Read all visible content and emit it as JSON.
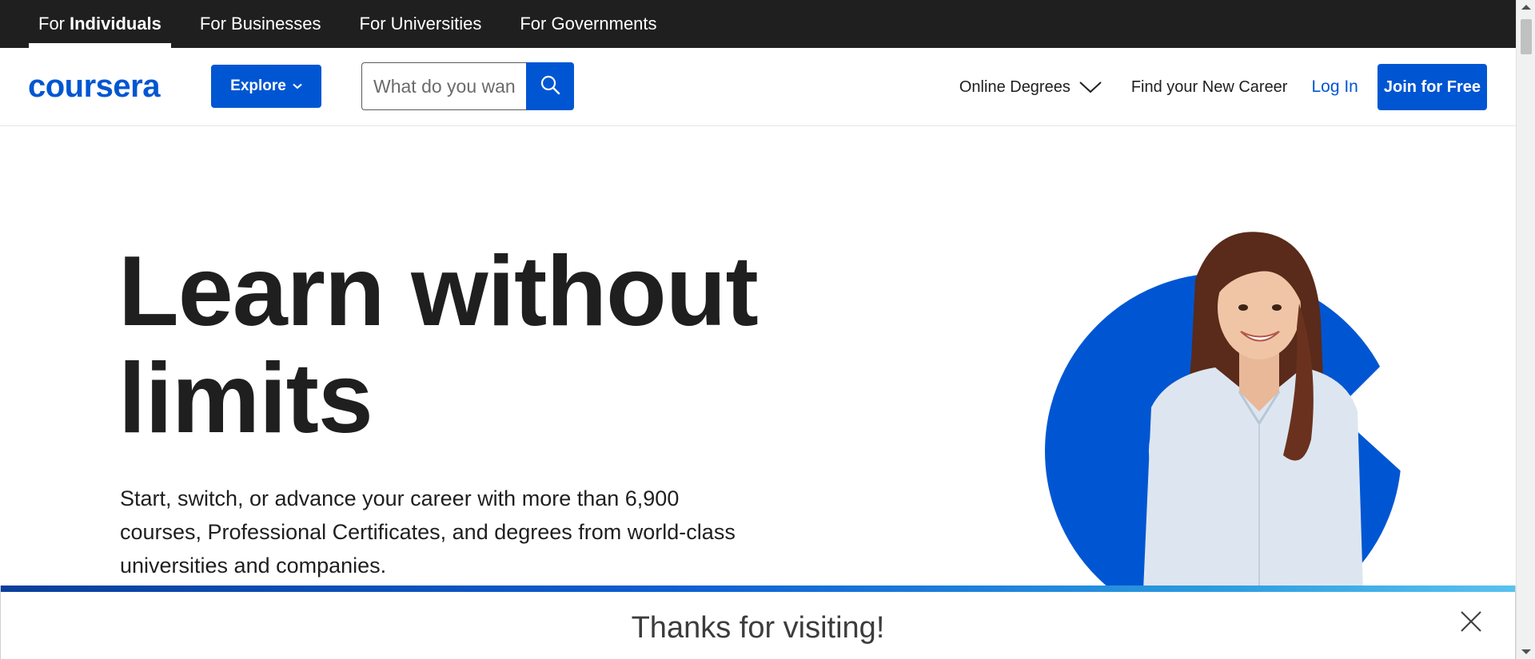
{
  "audience_nav": {
    "items": [
      {
        "prefix": "For",
        "strong": "Individuals",
        "active": true
      },
      {
        "label": "For Businesses"
      },
      {
        "label": "For Universities"
      },
      {
        "label": "For Governments"
      }
    ]
  },
  "header": {
    "logo": "coursera",
    "explore_label": "Explore",
    "search": {
      "placeholder": "What do you want to learn?",
      "value": ""
    },
    "online_degrees_label": "Online Degrees",
    "find_career_label": "Find your New Career",
    "login_label": "Log In",
    "join_label": "Join for Free"
  },
  "hero": {
    "title_line1": "Learn without",
    "title_line2": "limits",
    "subtitle": "Start, switch, or advance your career with more than 6,900 courses, Professional Certificates, and degrees from world-class universities and companies."
  },
  "banner": {
    "title": "Thanks for visiting!"
  },
  "icons": {
    "explore_chevron": "chevron-down-icon",
    "search": "search-icon",
    "degrees_chevron": "chevron-down-icon",
    "banner_close": "close-icon"
  },
  "colors": {
    "brand": "#0056d2",
    "top_bar": "#1f1f1f",
    "text": "#1f1f1f"
  }
}
